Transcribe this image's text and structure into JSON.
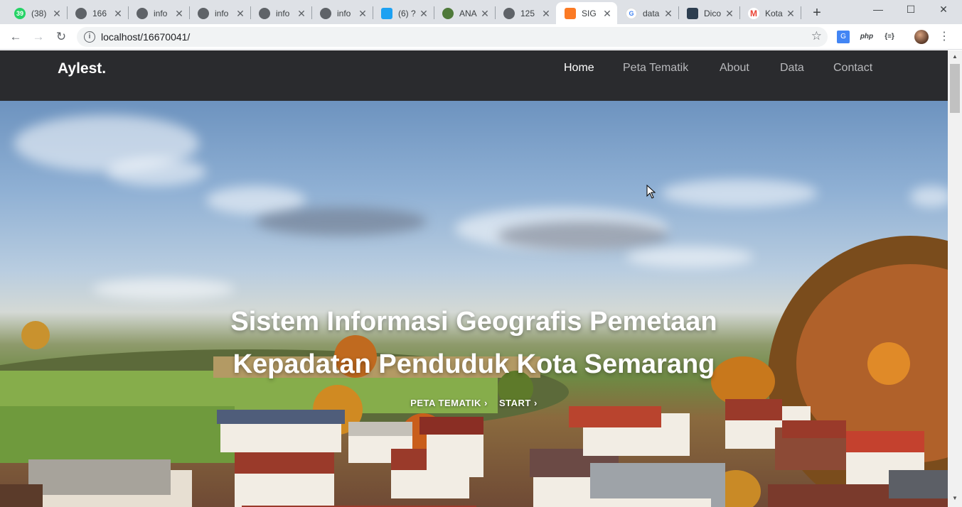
{
  "browser": {
    "tabs": [
      {
        "title": "(38)",
        "icon": "whatsapp-icon",
        "color": "#25d366",
        "badge": "39"
      },
      {
        "title": "166",
        "icon": "globe-icon",
        "color": "#5f6368"
      },
      {
        "title": "info",
        "icon": "globe-icon",
        "color": "#5f6368"
      },
      {
        "title": "info",
        "icon": "globe-icon",
        "color": "#5f6368"
      },
      {
        "title": "info",
        "icon": "globe-icon",
        "color": "#5f6368"
      },
      {
        "title": "info",
        "icon": "globe-icon",
        "color": "#5f6368"
      },
      {
        "title": "(6) ?",
        "icon": "twitter-icon",
        "color": "#1da1f2"
      },
      {
        "title": "ANA",
        "icon": "emblem-icon",
        "color": "#4f7a3a"
      },
      {
        "title": "125",
        "icon": "globe-icon",
        "color": "#5f6368"
      },
      {
        "title": "SIG",
        "icon": "xampp-icon",
        "color": "#fb7a24",
        "active": true
      },
      {
        "title": "data",
        "icon": "google-icon",
        "color": "#4285f4"
      },
      {
        "title": "Dico",
        "icon": "dicoding-icon",
        "color": "#2d3e50"
      },
      {
        "title": "Kota",
        "icon": "gmail-icon",
        "color": "#ea4335"
      }
    ],
    "new_tab": "+",
    "window_controls": {
      "minimize": "—",
      "maximize": "☐",
      "close": "✕"
    },
    "nav": {
      "back": "←",
      "forward": "→",
      "reload": "↻"
    },
    "url": "localhost/16670041/",
    "bookmark": "☆",
    "extensions": [
      {
        "label": "G",
        "icon": "translate-icon"
      },
      {
        "label": "php",
        "icon": "php-icon"
      },
      {
        "label": "{≡}",
        "icon": "json-icon"
      },
      {
        "label": "",
        "icon": "profile-avatar-icon"
      },
      {
        "label": "⋮",
        "icon": "menu-icon"
      }
    ]
  },
  "site": {
    "brand": "Aylest.",
    "nav": [
      {
        "label": "Home",
        "active": true
      },
      {
        "label": "Peta Tematik",
        "active": false
      },
      {
        "label": "About",
        "active": false
      },
      {
        "label": "Data",
        "active": false
      },
      {
        "label": "Contact",
        "active": false
      }
    ],
    "hero": {
      "title_line1": "Sistem Informasi Geografis Pemetaan",
      "title_line2": "Kepadatan Penduduk Kota Semarang",
      "link1": "PETA TEMATIK",
      "link2": "START",
      "chevron": "›"
    }
  },
  "scrollbar": {
    "up": "▲",
    "down": "▼"
  }
}
